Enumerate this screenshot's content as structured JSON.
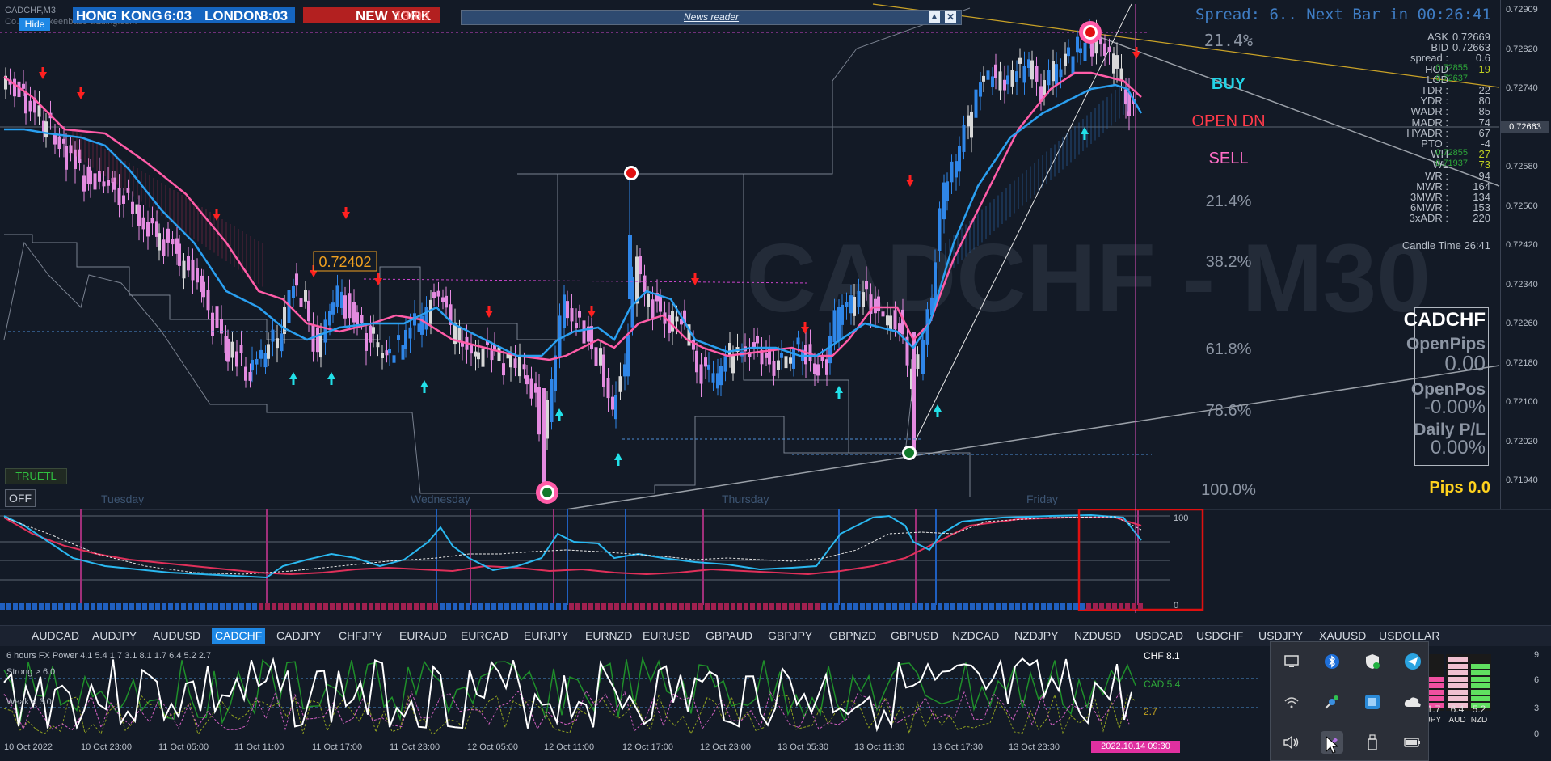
{
  "window": {
    "title_fragment": "CADCHF,M3",
    "hide_label": "Hide",
    "sub_caption": "Co… www.keenbase-trading.com"
  },
  "sessions": {
    "hong_kong": "HONG KONG",
    "hong_kong_time": "6:03",
    "london": "LONDON",
    "london_time": "8:03",
    "new_york": "NEW YORK",
    "new_york_time": "13:03"
  },
  "news_reader": {
    "label": "News reader"
  },
  "spread_line": "Spread: 6.. Next Bar in 00:26:41",
  "watermark": "CADCHF - M30",
  "fib_levels": [
    "21.4%",
    "21.4%",
    "38.2%",
    "61.8%",
    "78.6%",
    "100.0%"
  ],
  "signals": {
    "buy": "BUY",
    "open": "OPEN DN",
    "sell": "SELL"
  },
  "price_axis": [
    "0.72909",
    "0.72820",
    "0.72740",
    "0.72663",
    "0.72580",
    "0.72500",
    "0.72420",
    "0.72340",
    "0.72260",
    "0.72180",
    "0.72100",
    "0.72020",
    "0.71940"
  ],
  "current_price": "0.72663",
  "price_label": "0.72402",
  "stats": [
    {
      "label": "ASK",
      "value": "0.72669"
    },
    {
      "label": "BID",
      "value": "0.72663"
    },
    {
      "label": "spread :",
      "value": "0.6"
    },
    {
      "label": "HOD",
      "value": "0.72855",
      "extra": "19"
    },
    {
      "label": "LOD",
      "value": "0.72637",
      "extra": ""
    },
    {
      "label": "TDR :",
      "value": "22"
    },
    {
      "label": "YDR :",
      "value": "80"
    },
    {
      "label": "WADR :",
      "value": "85"
    },
    {
      "label": "MADR :",
      "value": "74"
    },
    {
      "label": "HYADR :",
      "value": "67"
    },
    {
      "label": "PTO :",
      "value": "-4"
    },
    {
      "label": "WH",
      "value": "0.72855",
      "extra": "27"
    },
    {
      "label": "WL",
      "value": "0.71937",
      "extra": "73"
    },
    {
      "label": "WR :",
      "value": "94"
    },
    {
      "label": "MWR :",
      "value": "164"
    },
    {
      "label": "3MWR :",
      "value": "134"
    },
    {
      "label": "6MWR :",
      "value": "153"
    },
    {
      "label": "3xADR :",
      "value": "220"
    }
  ],
  "candle_time": "Candle Time  26:41",
  "panel": {
    "symbol": "CADCHF",
    "open_pips_label": "OpenPips",
    "open_pips": "0.00",
    "open_pos_label": "OpenPos",
    "open_pos": "-0.00%",
    "daily_pl_label": "Daily P/L",
    "daily_pl": "0.00%",
    "pips": "Pips 0.0"
  },
  "day_labels": [
    "Tuesday",
    "Wednesday",
    "Thursday",
    "Friday"
  ],
  "buttons": {
    "truetl": "TRUETL",
    "off": "OFF"
  },
  "osc_scale": [
    "100",
    "0"
  ],
  "pairs": [
    "AUDCAD",
    "AUDJPY",
    "AUDUSD",
    "CADCHF",
    "CADJPY",
    "CHFJPY",
    "EURAUD",
    "EURCAD",
    "EURJPY",
    "EURNZD",
    "EURUSD",
    "GBPAUD",
    "GBPJPY",
    "GBPNZD",
    "GBPUSD",
    "NZDCAD",
    "NZDJPY",
    "NZDUSD",
    "USDCAD",
    "USDCHF",
    "USDJPY",
    "XAUUSD",
    "USDOLLAR"
  ],
  "active_pair": "CADCHF",
  "power": {
    "title": "6 hours FX Power 4.1 5.4 1.7 3.1 8.1 1.7 6.4 5.2 2.7",
    "strong": "Strong > 6.0",
    "weak": "Weak < 3.0",
    "chf": "CHF 8.1",
    "cad": "CAD 5.4",
    "third": "2.7",
    "scale": [
      "9",
      "6",
      "3",
      "0"
    ],
    "bar_values": [
      "1.7",
      "6.4",
      "5.2"
    ],
    "bar_labels": [
      "JPY",
      "AUD",
      "NZD"
    ]
  },
  "time_axis": [
    "10 Oct 2022",
    "10 Oct 23:00",
    "11 Oct 05:00",
    "11 Oct 11:00",
    "11 Oct 17:00",
    "11 Oct 23:00",
    "12 Oct 05:00",
    "12 Oct 11:00",
    "12 Oct 17:00",
    "12 Oct 23:00",
    "13 Oct 05:30",
    "13 Oct 11:30",
    "13 Oct 17:30",
    "13 Oct 23:30"
  ],
  "time_marker": "2022.10.14 09:30",
  "colors": {
    "bg": "#131a26",
    "bull": "#2f86e8",
    "bear": "#e48be0",
    "ma_pink": "#ff5ca8",
    "ma_blue": "#2a9ff0",
    "buy": "#22d3e6",
    "open": "#ff3b4a",
    "sell": "#ff6ec7",
    "fib": "#8c95a3",
    "pips": "#ffd21e"
  },
  "tray_icons": [
    "monitor-icon",
    "bluetooth-icon",
    "shield-icon",
    "telegram-icon",
    "wifi-icon",
    "satellite-icon",
    "app-icon",
    "cloud-icon",
    "speaker-icon",
    "pen-icon",
    "usb-icon",
    "battery-icon"
  ]
}
